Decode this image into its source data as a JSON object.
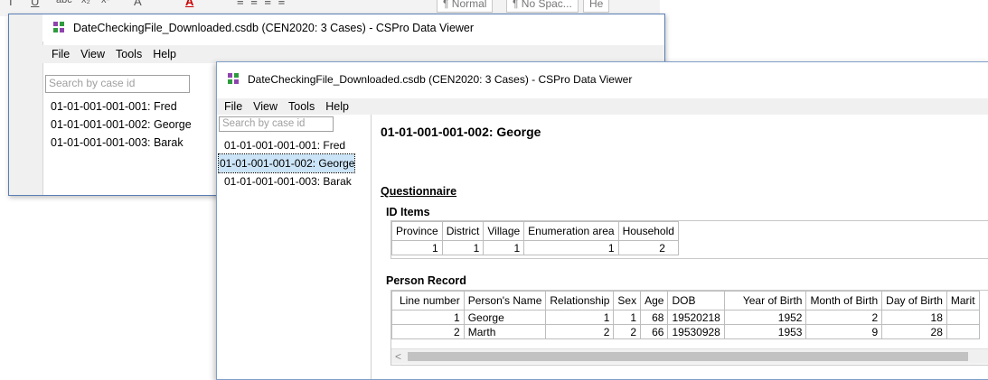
{
  "word_toolbar": {
    "glyphs": [
      "I",
      "U",
      "abc",
      "x₂",
      "x²",
      "A",
      "A"
    ],
    "styles": [
      "¶ Normal",
      "¶ No Spac...",
      "He"
    ]
  },
  "back_window": {
    "title": "DateCheckingFile_Downloaded.csdb (CEN2020: 3 Cases) - CSPro Data Viewer",
    "menu": [
      "File",
      "View",
      "Tools",
      "Help"
    ],
    "search_placeholder": "Search by case id",
    "cases": [
      "01-01-001-001-001: Fred",
      "01-01-001-001-002: George",
      "01-01-001-001-003: Barak"
    ]
  },
  "front_window": {
    "title": "DateCheckingFile_Downloaded.csdb (CEN2020: 3 Cases) - CSPro Data Viewer",
    "menu": [
      "File",
      "View",
      "Tools",
      "Help"
    ],
    "search_placeholder": "Search by case id",
    "cases": [
      "01-01-001-001-001: Fred",
      "01-01-001-001-002: George",
      "01-01-001-001-003: Barak"
    ],
    "selected_case_index": 1,
    "case_heading": "01-01-001-001-002: George",
    "questionnaire_label": "Questionnaire",
    "id_items": {
      "title": "ID Items",
      "headers": [
        "Province",
        "District",
        "Village",
        "Enumeration area",
        "Household"
      ],
      "row": [
        "1",
        "1",
        "1",
        "1",
        "2"
      ]
    },
    "person_record": {
      "title": "Person Record",
      "headers": [
        "Line number",
        "Person's Name",
        "Relationship",
        "Sex",
        "Age",
        "DOB",
        "Year of Birth",
        "Month of Birth",
        "Day of Birth",
        "Marit"
      ],
      "rows": [
        [
          "1",
          "George",
          "1",
          "1",
          "68",
          "19520218",
          "1952",
          "2",
          "18",
          ""
        ],
        [
          "2",
          "Marth",
          "2",
          "2",
          "66",
          "19530928",
          "1953",
          "9",
          "28",
          ""
        ]
      ]
    },
    "scroll_left_glyph": "<"
  },
  "colors": {
    "icon_purple": "#8e44ad",
    "icon_green": "#2e9b3f",
    "selection_bg": "#cce4f7",
    "menubar_bg": "#f0f0f0",
    "window_border": "#7f9fc8"
  },
  "icons": [
    "cspro-app-icon",
    "scroll-left-arrow-icon"
  ]
}
